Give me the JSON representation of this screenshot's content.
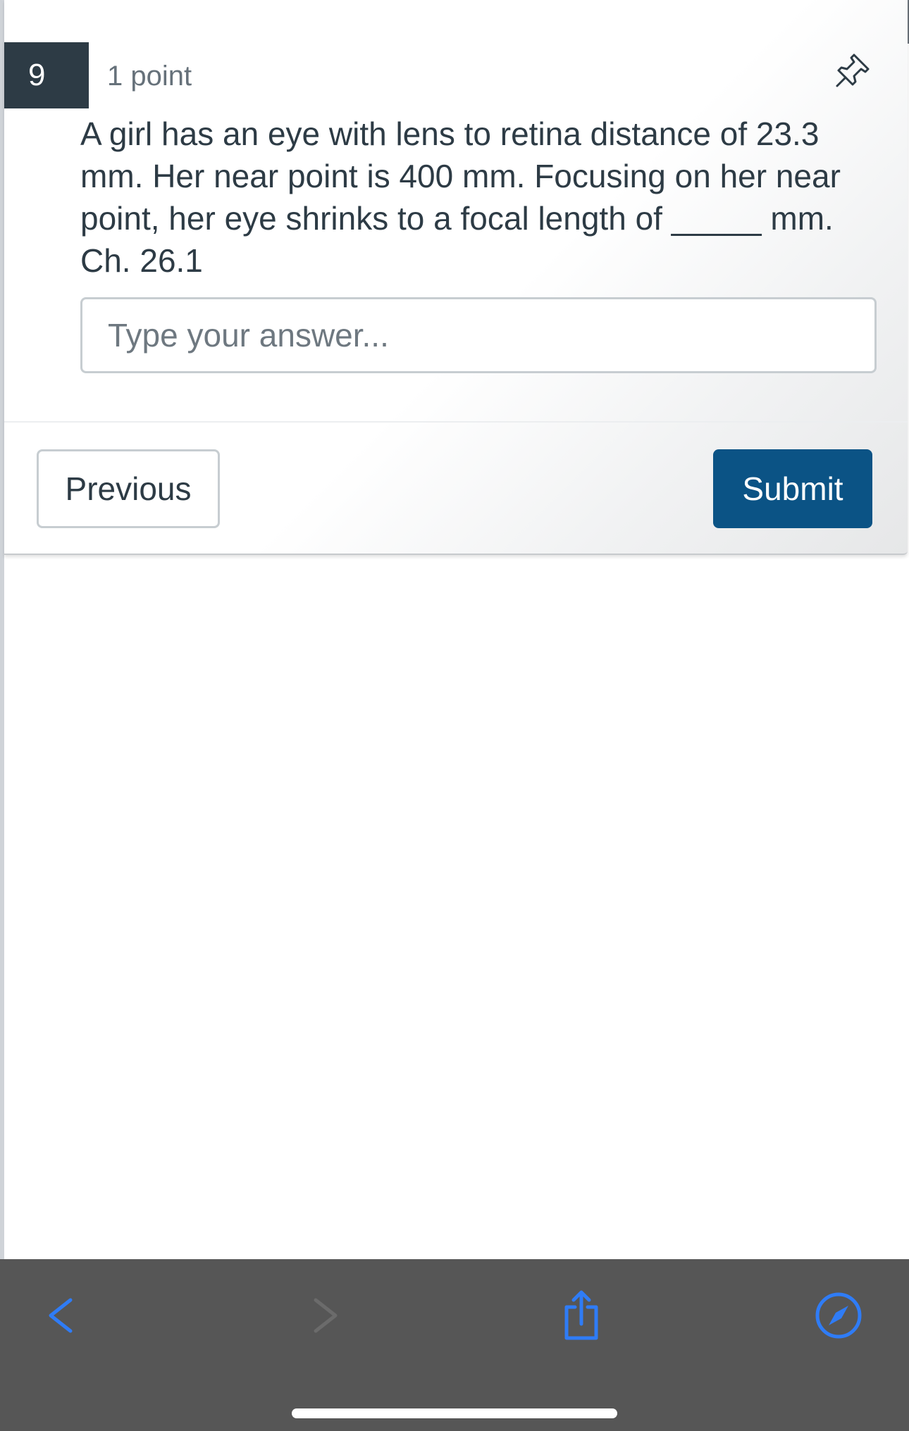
{
  "question": {
    "number": "9",
    "points": "1 point",
    "text": "A girl has an eye with lens to retina distance of 23.3\nmm.  Her near point is 400 mm.  Focusing on her near\npoint, her eye shrinks to a focal length of _____ mm.\nCh. 26.1",
    "pin_icon": "pin-icon"
  },
  "answer": {
    "value": "",
    "placeholder": "Type your answer..."
  },
  "navigation": {
    "previous_label": "Previous",
    "submit_label": "Submit"
  },
  "colors": {
    "question_badge": "#2d3b45",
    "submit_button": "#0b5385",
    "text": "#2d3b45",
    "toolbar": "#565656",
    "toolbar_active_icon": "#2f7cf6",
    "toolbar_disabled_icon": "#6b6b6b"
  },
  "browser_toolbar": {
    "icons": [
      "back-chevron-icon",
      "forward-chevron-icon",
      "share-icon",
      "compass-icon"
    ]
  }
}
